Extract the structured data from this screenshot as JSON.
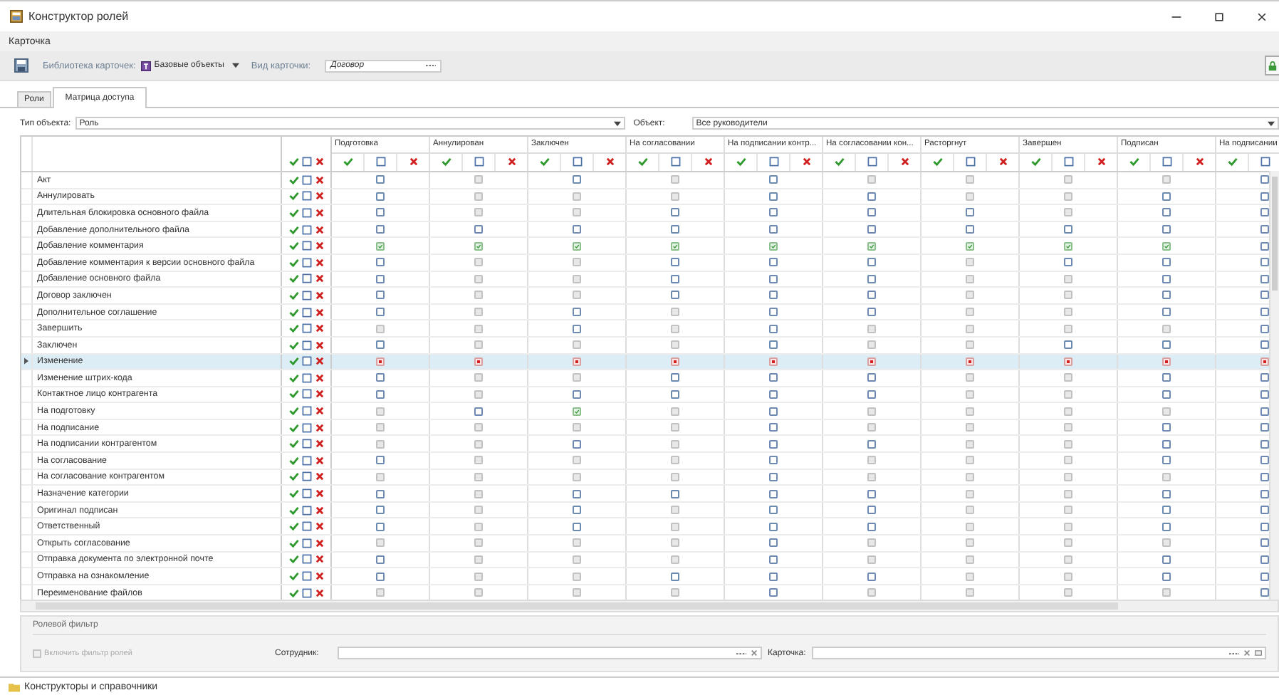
{
  "window": {
    "title": "Конструктор ролей"
  },
  "menu": [
    "Карточка"
  ],
  "toolbar": {
    "library_label": "Библиотека карточек:",
    "library_value": "Базовые объекты",
    "card_type_label": "Вид карточки:",
    "card_type_value": "Договор"
  },
  "tabs": [
    {
      "label": "Роли",
      "selected": false
    },
    {
      "label": "Матрица доступа",
      "selected": true
    }
  ],
  "filter_row": {
    "type_label": "Тип объекта:",
    "type_value": "Роль",
    "object_label": "Объект:",
    "object_value": "Все руководители"
  },
  "grid": {
    "columns": [
      "Подготовка",
      "Аннулирован",
      "Заключен",
      "На согласовании",
      "На подписании контр...",
      "На согласовании кон...",
      "Расторгнут",
      "Завершен",
      "Подписан",
      "На подписании"
    ],
    "rows": [
      {
        "label": "Акт",
        "selected": false,
        "cells": [
          {
            "checked": false,
            "denied": false,
            "disabled": false
          },
          {
            "checked": false,
            "denied": false,
            "disabled": true
          },
          {
            "checked": false,
            "denied": false,
            "disabled": false
          },
          {
            "checked": false,
            "denied": false,
            "disabled": true
          },
          {
            "checked": false,
            "denied": false,
            "disabled": false
          },
          {
            "checked": false,
            "denied": false,
            "disabled": true
          },
          {
            "checked": false,
            "denied": false,
            "disabled": true
          },
          {
            "checked": false,
            "denied": false,
            "disabled": true
          },
          {
            "checked": false,
            "denied": false,
            "disabled": true
          },
          {
            "checked": false,
            "denied": false,
            "disabled": false
          }
        ]
      },
      {
        "label": "Аннулировать",
        "selected": false,
        "cells": [
          {
            "checked": false,
            "denied": false,
            "disabled": false
          },
          {
            "checked": false,
            "denied": false,
            "disabled": true
          },
          {
            "checked": false,
            "denied": false,
            "disabled": true
          },
          {
            "checked": false,
            "denied": false,
            "disabled": true
          },
          {
            "checked": false,
            "denied": false,
            "disabled": false
          },
          {
            "checked": false,
            "denied": false,
            "disabled": false
          },
          {
            "checked": false,
            "denied": false,
            "disabled": true
          },
          {
            "checked": false,
            "denied": false,
            "disabled": true
          },
          {
            "checked": false,
            "denied": false,
            "disabled": false
          },
          {
            "checked": false,
            "denied": false,
            "disabled": false
          }
        ]
      },
      {
        "label": "Длительная блокировка основного файла",
        "selected": false,
        "cells": [
          {
            "checked": false,
            "denied": false,
            "disabled": false
          },
          {
            "checked": false,
            "denied": false,
            "disabled": true
          },
          {
            "checked": false,
            "denied": false,
            "disabled": true
          },
          {
            "checked": false,
            "denied": false,
            "disabled": false
          },
          {
            "checked": false,
            "denied": false,
            "disabled": false
          },
          {
            "checked": false,
            "denied": false,
            "disabled": false
          },
          {
            "checked": false,
            "denied": false,
            "disabled": false
          },
          {
            "checked": false,
            "denied": false,
            "disabled": true
          },
          {
            "checked": false,
            "denied": false,
            "disabled": false
          },
          {
            "checked": false,
            "denied": false,
            "disabled": false
          }
        ]
      },
      {
        "label": "Добавление дополнительного файла",
        "selected": false,
        "cells": [
          {
            "checked": false,
            "denied": false,
            "disabled": false
          },
          {
            "checked": false,
            "denied": false,
            "disabled": false
          },
          {
            "checked": false,
            "denied": false,
            "disabled": false
          },
          {
            "checked": false,
            "denied": false,
            "disabled": false
          },
          {
            "checked": false,
            "denied": false,
            "disabled": false
          },
          {
            "checked": false,
            "denied": false,
            "disabled": false
          },
          {
            "checked": false,
            "denied": false,
            "disabled": false
          },
          {
            "checked": false,
            "denied": false,
            "disabled": false
          },
          {
            "checked": false,
            "denied": false,
            "disabled": false
          },
          {
            "checked": false,
            "denied": false,
            "disabled": false
          }
        ]
      },
      {
        "label": "Добавление комментария",
        "selected": false,
        "cells": [
          {
            "checked": true,
            "denied": false,
            "disabled": false
          },
          {
            "checked": true,
            "denied": false,
            "disabled": false
          },
          {
            "checked": true,
            "denied": false,
            "disabled": false
          },
          {
            "checked": true,
            "denied": false,
            "disabled": false
          },
          {
            "checked": true,
            "denied": false,
            "disabled": false
          },
          {
            "checked": true,
            "denied": false,
            "disabled": false
          },
          {
            "checked": true,
            "denied": false,
            "disabled": false
          },
          {
            "checked": true,
            "denied": false,
            "disabled": false
          },
          {
            "checked": true,
            "denied": false,
            "disabled": false
          },
          {
            "checked": false,
            "denied": false,
            "disabled": false
          }
        ]
      },
      {
        "label": "Добавление комментария к версии основного файла",
        "selected": false,
        "cells": [
          {
            "checked": false,
            "denied": false,
            "disabled": false
          },
          {
            "checked": false,
            "denied": false,
            "disabled": true
          },
          {
            "checked": false,
            "denied": false,
            "disabled": true
          },
          {
            "checked": false,
            "denied": false,
            "disabled": false
          },
          {
            "checked": false,
            "denied": false,
            "disabled": false
          },
          {
            "checked": false,
            "denied": false,
            "disabled": false
          },
          {
            "checked": false,
            "denied": false,
            "disabled": true
          },
          {
            "checked": false,
            "denied": false,
            "disabled": false
          },
          {
            "checked": false,
            "denied": false,
            "disabled": false
          },
          {
            "checked": false,
            "denied": false,
            "disabled": false
          }
        ]
      },
      {
        "label": "Добавление основного файла",
        "selected": false,
        "cells": [
          {
            "checked": false,
            "denied": false,
            "disabled": false
          },
          {
            "checked": false,
            "denied": false,
            "disabled": true
          },
          {
            "checked": false,
            "denied": false,
            "disabled": true
          },
          {
            "checked": false,
            "denied": false,
            "disabled": false
          },
          {
            "checked": false,
            "denied": false,
            "disabled": false
          },
          {
            "checked": false,
            "denied": false,
            "disabled": false
          },
          {
            "checked": false,
            "denied": false,
            "disabled": true
          },
          {
            "checked": false,
            "denied": false,
            "disabled": true
          },
          {
            "checked": false,
            "denied": false,
            "disabled": false
          },
          {
            "checked": false,
            "denied": false,
            "disabled": false
          }
        ]
      },
      {
        "label": "Договор заключен",
        "selected": false,
        "cells": [
          {
            "checked": false,
            "denied": false,
            "disabled": false
          },
          {
            "checked": false,
            "denied": false,
            "disabled": true
          },
          {
            "checked": false,
            "denied": false,
            "disabled": true
          },
          {
            "checked": false,
            "denied": false,
            "disabled": false
          },
          {
            "checked": false,
            "denied": false,
            "disabled": false
          },
          {
            "checked": false,
            "denied": false,
            "disabled": false
          },
          {
            "checked": false,
            "denied": false,
            "disabled": true
          },
          {
            "checked": false,
            "denied": false,
            "disabled": true
          },
          {
            "checked": false,
            "denied": false,
            "disabled": false
          },
          {
            "checked": false,
            "denied": false,
            "disabled": false
          }
        ]
      },
      {
        "label": "Дополнительное соглашение",
        "selected": false,
        "cells": [
          {
            "checked": false,
            "denied": false,
            "disabled": false
          },
          {
            "checked": false,
            "denied": false,
            "disabled": true
          },
          {
            "checked": false,
            "denied": false,
            "disabled": false
          },
          {
            "checked": false,
            "denied": false,
            "disabled": true
          },
          {
            "checked": false,
            "denied": false,
            "disabled": false
          },
          {
            "checked": false,
            "denied": false,
            "disabled": false
          },
          {
            "checked": false,
            "denied": false,
            "disabled": true
          },
          {
            "checked": false,
            "denied": false,
            "disabled": true
          },
          {
            "checked": false,
            "denied": false,
            "disabled": false
          },
          {
            "checked": false,
            "denied": false,
            "disabled": false
          }
        ]
      },
      {
        "label": "Завершить",
        "selected": false,
        "cells": [
          {
            "checked": false,
            "denied": false,
            "disabled": true
          },
          {
            "checked": false,
            "denied": false,
            "disabled": true
          },
          {
            "checked": false,
            "denied": false,
            "disabled": false
          },
          {
            "checked": false,
            "denied": false,
            "disabled": true
          },
          {
            "checked": false,
            "denied": false,
            "disabled": false
          },
          {
            "checked": false,
            "denied": false,
            "disabled": true
          },
          {
            "checked": false,
            "denied": false,
            "disabled": true
          },
          {
            "checked": false,
            "denied": false,
            "disabled": true
          },
          {
            "checked": false,
            "denied": false,
            "disabled": true
          },
          {
            "checked": false,
            "denied": false,
            "disabled": false
          }
        ]
      },
      {
        "label": "Заключен",
        "selected": false,
        "cells": [
          {
            "checked": false,
            "denied": false,
            "disabled": false
          },
          {
            "checked": false,
            "denied": false,
            "disabled": true
          },
          {
            "checked": false,
            "denied": false,
            "disabled": true
          },
          {
            "checked": false,
            "denied": false,
            "disabled": true
          },
          {
            "checked": false,
            "denied": false,
            "disabled": false
          },
          {
            "checked": false,
            "denied": false,
            "disabled": true
          },
          {
            "checked": false,
            "denied": false,
            "disabled": true
          },
          {
            "checked": false,
            "denied": false,
            "disabled": false
          },
          {
            "checked": false,
            "denied": false,
            "disabled": false
          },
          {
            "checked": false,
            "denied": false,
            "disabled": false
          }
        ]
      },
      {
        "label": "Изменение",
        "selected": true,
        "cells": [
          {
            "checked": false,
            "denied": true,
            "disabled": false
          },
          {
            "checked": false,
            "denied": true,
            "disabled": false
          },
          {
            "checked": false,
            "denied": true,
            "disabled": false
          },
          {
            "checked": false,
            "denied": true,
            "disabled": false
          },
          {
            "checked": false,
            "denied": true,
            "disabled": false
          },
          {
            "checked": false,
            "denied": true,
            "disabled": false
          },
          {
            "checked": false,
            "denied": true,
            "disabled": false
          },
          {
            "checked": false,
            "denied": true,
            "disabled": false
          },
          {
            "checked": false,
            "denied": true,
            "disabled": false
          },
          {
            "checked": false,
            "denied": true,
            "disabled": false
          }
        ]
      },
      {
        "label": "Изменение штрих-кода",
        "selected": false,
        "cells": [
          {
            "checked": false,
            "denied": false,
            "disabled": false
          },
          {
            "checked": false,
            "denied": false,
            "disabled": true
          },
          {
            "checked": false,
            "denied": false,
            "disabled": true
          },
          {
            "checked": false,
            "denied": false,
            "disabled": false
          },
          {
            "checked": false,
            "denied": false,
            "disabled": false
          },
          {
            "checked": false,
            "denied": false,
            "disabled": false
          },
          {
            "checked": false,
            "denied": false,
            "disabled": true
          },
          {
            "checked": false,
            "denied": false,
            "disabled": true
          },
          {
            "checked": false,
            "denied": false,
            "disabled": false
          },
          {
            "checked": false,
            "denied": false,
            "disabled": false
          }
        ]
      },
      {
        "label": "Контактное лицо контрагента",
        "selected": false,
        "cells": [
          {
            "checked": false,
            "denied": false,
            "disabled": false
          },
          {
            "checked": false,
            "denied": false,
            "disabled": true
          },
          {
            "checked": false,
            "denied": false,
            "disabled": false
          },
          {
            "checked": false,
            "denied": false,
            "disabled": false
          },
          {
            "checked": false,
            "denied": false,
            "disabled": false
          },
          {
            "checked": false,
            "denied": false,
            "disabled": false
          },
          {
            "checked": false,
            "denied": false,
            "disabled": true
          },
          {
            "checked": false,
            "denied": false,
            "disabled": true
          },
          {
            "checked": false,
            "denied": false,
            "disabled": false
          },
          {
            "checked": false,
            "denied": false,
            "disabled": false
          }
        ]
      },
      {
        "label": "На подготовку",
        "selected": false,
        "cells": [
          {
            "checked": false,
            "denied": false,
            "disabled": true
          },
          {
            "checked": false,
            "denied": false,
            "disabled": false
          },
          {
            "checked": true,
            "denied": false,
            "disabled": false
          },
          {
            "checked": false,
            "denied": false,
            "disabled": true
          },
          {
            "checked": false,
            "denied": false,
            "disabled": false
          },
          {
            "checked": false,
            "denied": false,
            "disabled": true
          },
          {
            "checked": false,
            "denied": false,
            "disabled": true
          },
          {
            "checked": false,
            "denied": false,
            "disabled": true
          },
          {
            "checked": false,
            "denied": false,
            "disabled": true
          },
          {
            "checked": false,
            "denied": false,
            "disabled": false
          }
        ]
      },
      {
        "label": "На подписание",
        "selected": false,
        "cells": [
          {
            "checked": false,
            "denied": false,
            "disabled": true
          },
          {
            "checked": false,
            "denied": false,
            "disabled": true
          },
          {
            "checked": false,
            "denied": false,
            "disabled": true
          },
          {
            "checked": false,
            "denied": false,
            "disabled": true
          },
          {
            "checked": false,
            "denied": false,
            "disabled": false
          },
          {
            "checked": false,
            "denied": false,
            "disabled": true
          },
          {
            "checked": false,
            "denied": false,
            "disabled": true
          },
          {
            "checked": false,
            "denied": false,
            "disabled": true
          },
          {
            "checked": false,
            "denied": false,
            "disabled": false
          },
          {
            "checked": false,
            "denied": false,
            "disabled": false
          }
        ]
      },
      {
        "label": "На подписании контрагентом",
        "selected": false,
        "cells": [
          {
            "checked": false,
            "denied": false,
            "disabled": true
          },
          {
            "checked": false,
            "denied": false,
            "disabled": true
          },
          {
            "checked": false,
            "denied": false,
            "disabled": false
          },
          {
            "checked": false,
            "denied": false,
            "disabled": true
          },
          {
            "checked": false,
            "denied": false,
            "disabled": false
          },
          {
            "checked": false,
            "denied": false,
            "disabled": false
          },
          {
            "checked": false,
            "denied": false,
            "disabled": true
          },
          {
            "checked": false,
            "denied": false,
            "disabled": true
          },
          {
            "checked": false,
            "denied": false,
            "disabled": false
          },
          {
            "checked": false,
            "denied": false,
            "disabled": false
          }
        ]
      },
      {
        "label": "На согласование",
        "selected": false,
        "cells": [
          {
            "checked": false,
            "denied": false,
            "disabled": false
          },
          {
            "checked": false,
            "denied": false,
            "disabled": true
          },
          {
            "checked": false,
            "denied": false,
            "disabled": true
          },
          {
            "checked": false,
            "denied": false,
            "disabled": true
          },
          {
            "checked": false,
            "denied": false,
            "disabled": false
          },
          {
            "checked": false,
            "denied": false,
            "disabled": true
          },
          {
            "checked": false,
            "denied": false,
            "disabled": true
          },
          {
            "checked": false,
            "denied": false,
            "disabled": true
          },
          {
            "checked": false,
            "denied": false,
            "disabled": false
          },
          {
            "checked": false,
            "denied": false,
            "disabled": false
          }
        ]
      },
      {
        "label": "На согласование контрагентом",
        "selected": false,
        "cells": [
          {
            "checked": false,
            "denied": false,
            "disabled": true
          },
          {
            "checked": false,
            "denied": false,
            "disabled": true
          },
          {
            "checked": false,
            "denied": false,
            "disabled": true
          },
          {
            "checked": false,
            "denied": false,
            "disabled": true
          },
          {
            "checked": false,
            "denied": false,
            "disabled": false
          },
          {
            "checked": false,
            "denied": false,
            "disabled": true
          },
          {
            "checked": false,
            "denied": false,
            "disabled": true
          },
          {
            "checked": false,
            "denied": false,
            "disabled": true
          },
          {
            "checked": false,
            "denied": false,
            "disabled": true
          },
          {
            "checked": false,
            "denied": false,
            "disabled": false
          }
        ]
      },
      {
        "label": "Назначение категории",
        "selected": false,
        "cells": [
          {
            "checked": false,
            "denied": false,
            "disabled": false
          },
          {
            "checked": false,
            "denied": false,
            "disabled": true
          },
          {
            "checked": false,
            "denied": false,
            "disabled": false
          },
          {
            "checked": false,
            "denied": false,
            "disabled": false
          },
          {
            "checked": false,
            "denied": false,
            "disabled": false
          },
          {
            "checked": false,
            "denied": false,
            "disabled": false
          },
          {
            "checked": false,
            "denied": false,
            "disabled": true
          },
          {
            "checked": false,
            "denied": false,
            "disabled": true
          },
          {
            "checked": false,
            "denied": false,
            "disabled": false
          },
          {
            "checked": false,
            "denied": false,
            "disabled": false
          }
        ]
      },
      {
        "label": "Оригинал подписан",
        "selected": false,
        "cells": [
          {
            "checked": false,
            "denied": false,
            "disabled": false
          },
          {
            "checked": false,
            "denied": false,
            "disabled": true
          },
          {
            "checked": false,
            "denied": false,
            "disabled": false
          },
          {
            "checked": false,
            "denied": false,
            "disabled": true
          },
          {
            "checked": false,
            "denied": false,
            "disabled": false
          },
          {
            "checked": false,
            "denied": false,
            "disabled": false
          },
          {
            "checked": false,
            "denied": false,
            "disabled": true
          },
          {
            "checked": false,
            "denied": false,
            "disabled": true
          },
          {
            "checked": false,
            "denied": false,
            "disabled": false
          },
          {
            "checked": false,
            "denied": false,
            "disabled": false
          }
        ]
      },
      {
        "label": "Ответственный",
        "selected": false,
        "cells": [
          {
            "checked": false,
            "denied": false,
            "disabled": false
          },
          {
            "checked": false,
            "denied": false,
            "disabled": true
          },
          {
            "checked": false,
            "denied": false,
            "disabled": false
          },
          {
            "checked": false,
            "denied": false,
            "disabled": true
          },
          {
            "checked": false,
            "denied": false,
            "disabled": false
          },
          {
            "checked": false,
            "denied": false,
            "disabled": false
          },
          {
            "checked": false,
            "denied": false,
            "disabled": true
          },
          {
            "checked": false,
            "denied": false,
            "disabled": true
          },
          {
            "checked": false,
            "denied": false,
            "disabled": false
          },
          {
            "checked": false,
            "denied": false,
            "disabled": false
          }
        ]
      },
      {
        "label": "Открыть согласование",
        "selected": false,
        "cells": [
          {
            "checked": false,
            "denied": false,
            "disabled": true
          },
          {
            "checked": false,
            "denied": false,
            "disabled": true
          },
          {
            "checked": false,
            "denied": false,
            "disabled": true
          },
          {
            "checked": false,
            "denied": false,
            "disabled": true
          },
          {
            "checked": false,
            "denied": false,
            "disabled": false
          },
          {
            "checked": false,
            "denied": false,
            "disabled": true
          },
          {
            "checked": false,
            "denied": false,
            "disabled": true
          },
          {
            "checked": false,
            "denied": false,
            "disabled": true
          },
          {
            "checked": false,
            "denied": false,
            "disabled": true
          },
          {
            "checked": false,
            "denied": false,
            "disabled": false
          }
        ]
      },
      {
        "label": "Отправка документа по электронной почте",
        "selected": false,
        "cells": [
          {
            "checked": false,
            "denied": false,
            "disabled": false
          },
          {
            "checked": false,
            "denied": false,
            "disabled": true
          },
          {
            "checked": false,
            "denied": false,
            "disabled": true
          },
          {
            "checked": false,
            "denied": false,
            "disabled": true
          },
          {
            "checked": false,
            "denied": false,
            "disabled": false
          },
          {
            "checked": false,
            "denied": false,
            "disabled": true
          },
          {
            "checked": false,
            "denied": false,
            "disabled": true
          },
          {
            "checked": false,
            "denied": false,
            "disabled": true
          },
          {
            "checked": false,
            "denied": false,
            "disabled": false
          },
          {
            "checked": false,
            "denied": false,
            "disabled": false
          }
        ]
      },
      {
        "label": "Отправка на ознакомление",
        "selected": false,
        "cells": [
          {
            "checked": false,
            "denied": false,
            "disabled": false
          },
          {
            "checked": false,
            "denied": false,
            "disabled": true
          },
          {
            "checked": false,
            "denied": false,
            "disabled": true
          },
          {
            "checked": false,
            "denied": false,
            "disabled": false
          },
          {
            "checked": false,
            "denied": false,
            "disabled": false
          },
          {
            "checked": false,
            "denied": false,
            "disabled": false
          },
          {
            "checked": false,
            "denied": false,
            "disabled": true
          },
          {
            "checked": false,
            "denied": false,
            "disabled": true
          },
          {
            "checked": false,
            "denied": false,
            "disabled": false
          },
          {
            "checked": false,
            "denied": false,
            "disabled": false
          }
        ]
      },
      {
        "label": "Переименование файлов",
        "selected": false,
        "cells": [
          {
            "checked": false,
            "denied": false,
            "disabled": true
          },
          {
            "checked": false,
            "denied": false,
            "disabled": true
          },
          {
            "checked": false,
            "denied": false,
            "disabled": true
          },
          {
            "checked": false,
            "denied": false,
            "disabled": true
          },
          {
            "checked": false,
            "denied": false,
            "disabled": false
          },
          {
            "checked": false,
            "denied": false,
            "disabled": true
          },
          {
            "checked": false,
            "denied": false,
            "disabled": true
          },
          {
            "checked": false,
            "denied": false,
            "disabled": true
          },
          {
            "checked": false,
            "denied": false,
            "disabled": true
          },
          {
            "checked": false,
            "denied": false,
            "disabled": false
          }
        ]
      }
    ]
  },
  "role_filter": {
    "title": "Ролевой фильтр",
    "enable_label": "Включить фильтр ролей",
    "enable_checked": false,
    "enable_disabled": true,
    "employee_label": "Сотрудник:",
    "card_label": "Карточка:"
  },
  "taskbar": {
    "label": "Конструкторы и справочники"
  }
}
